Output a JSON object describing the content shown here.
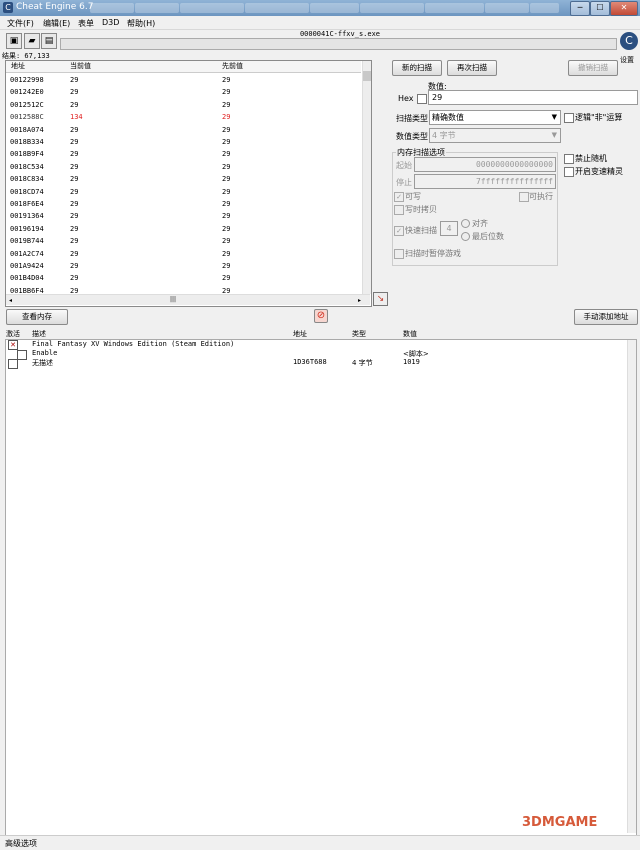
{
  "window": {
    "title": "Cheat Engine 6.7",
    "background_tabs": [
      "",
      "",
      "",
      "",
      "",
      "",
      "",
      "",
      "",
      ""
    ],
    "controls": [
      "─",
      "☐",
      "✕"
    ]
  },
  "menu": [
    "文件(F)",
    "编辑(E)",
    "表单",
    "D3D",
    "帮助(H)"
  ],
  "toolbar": {
    "process_name": "0000041C-ffxv_s.exe",
    "settings_label": "设置"
  },
  "results": {
    "count_label": "结果: 67,133",
    "columns": [
      "地址",
      "当前值",
      "先前值"
    ],
    "rows": [
      {
        "addr": "00122998",
        "cur": "29",
        "prev": "29"
      },
      {
        "addr": "001242E0",
        "cur": "29",
        "prev": "29"
      },
      {
        "addr": "0012512C",
        "cur": "29",
        "prev": "29"
      },
      {
        "addr": "0012588C",
        "cur": "134",
        "prev": "29"
      },
      {
        "addr": "0018A074",
        "cur": "29",
        "prev": "29"
      },
      {
        "addr": "0018B334",
        "cur": "29",
        "prev": "29"
      },
      {
        "addr": "0018B9F4",
        "cur": "29",
        "prev": "29"
      },
      {
        "addr": "0018C534",
        "cur": "29",
        "prev": "29"
      },
      {
        "addr": "0018C834",
        "cur": "29",
        "prev": "29"
      },
      {
        "addr": "0018CD74",
        "cur": "29",
        "prev": "29"
      },
      {
        "addr": "0018F6E4",
        "cur": "29",
        "prev": "29"
      },
      {
        "addr": "00191364",
        "cur": "29",
        "prev": "29"
      },
      {
        "addr": "00196194",
        "cur": "29",
        "prev": "29"
      },
      {
        "addr": "0019B744",
        "cur": "29",
        "prev": "29"
      },
      {
        "addr": "001A2C74",
        "cur": "29",
        "prev": "29"
      },
      {
        "addr": "001A9424",
        "cur": "29",
        "prev": "29"
      },
      {
        "addr": "001B4D04",
        "cur": "29",
        "prev": "29"
      },
      {
        "addr": "001BB6F4",
        "cur": "29",
        "prev": "29"
      }
    ],
    "hscroll_grip": "|||"
  },
  "scan": {
    "new_scan": "新的扫描",
    "next_scan": "再次扫描",
    "undo_scan": "撤销扫描",
    "value_label": "数值:",
    "hex_label": "Hex",
    "value": "29",
    "scan_type_label": "扫描类型",
    "scan_type": "精确数值",
    "value_type_label": "数值类型",
    "value_type": "4 字节",
    "not_op": "逻辑\"非\"运算",
    "mem_options_label": "内存扫描选项",
    "start_label": "起始",
    "start_value": "0000000000000000",
    "stop_label": "停止",
    "stop_value": "7fffffffffffffff",
    "writable": "可写",
    "executable": "可执行",
    "copy_on_write": "写时拷贝",
    "fast_scan": "快速扫描",
    "fast_scan_value": "4",
    "align": "对齐",
    "last_digits": "最后位数",
    "pause_game": "扫描时暂停游戏",
    "disable_random": "禁止随机",
    "speedhack": "开启变速精灵"
  },
  "actions": {
    "memory_view": "查看内存",
    "add_manual": "手动添加地址"
  },
  "address_list": {
    "columns": [
      "激活",
      "描述",
      "地址",
      "类型",
      "数值"
    ],
    "rows": [
      {
        "active": "✕",
        "desc": "Final Fantasy XV Windows Edition (Steam Edition)",
        "addr": "",
        "type": "",
        "value": ""
      },
      {
        "active": "",
        "desc": "Enable",
        "addr": "",
        "type": "",
        "value": "<脚本>"
      },
      {
        "active": "",
        "desc": "无描述",
        "addr": "1D36T688",
        "type": "4 字节",
        "value": "1019"
      }
    ]
  },
  "status": {
    "advanced": "高级选项"
  },
  "watermark": "3DMGAME"
}
